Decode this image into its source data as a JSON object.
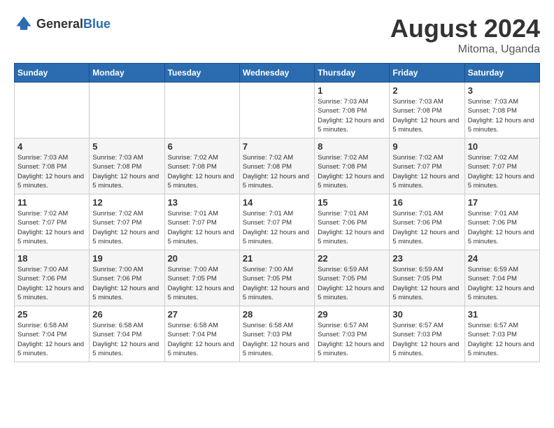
{
  "header": {
    "logo_general": "General",
    "logo_blue": "Blue",
    "month_title": "August 2024",
    "location": "Mitoma, Uganda"
  },
  "weekdays": [
    "Sunday",
    "Monday",
    "Tuesday",
    "Wednesday",
    "Thursday",
    "Friday",
    "Saturday"
  ],
  "weeks": [
    [
      {
        "day": "",
        "sunrise": "",
        "sunset": "",
        "daylight": ""
      },
      {
        "day": "",
        "sunrise": "",
        "sunset": "",
        "daylight": ""
      },
      {
        "day": "",
        "sunrise": "",
        "sunset": "",
        "daylight": ""
      },
      {
        "day": "",
        "sunrise": "",
        "sunset": "",
        "daylight": ""
      },
      {
        "day": "1",
        "sunrise": "Sunrise: 7:03 AM",
        "sunset": "Sunset: 7:08 PM",
        "daylight": "Daylight: 12 hours and 5 minutes."
      },
      {
        "day": "2",
        "sunrise": "Sunrise: 7:03 AM",
        "sunset": "Sunset: 7:08 PM",
        "daylight": "Daylight: 12 hours and 5 minutes."
      },
      {
        "day": "3",
        "sunrise": "Sunrise: 7:03 AM",
        "sunset": "Sunset: 7:08 PM",
        "daylight": "Daylight: 12 hours and 5 minutes."
      }
    ],
    [
      {
        "day": "4",
        "sunrise": "Sunrise: 7:03 AM",
        "sunset": "Sunset: 7:08 PM",
        "daylight": "Daylight: 12 hours and 5 minutes."
      },
      {
        "day": "5",
        "sunrise": "Sunrise: 7:03 AM",
        "sunset": "Sunset: 7:08 PM",
        "daylight": "Daylight: 12 hours and 5 minutes."
      },
      {
        "day": "6",
        "sunrise": "Sunrise: 7:02 AM",
        "sunset": "Sunset: 7:08 PM",
        "daylight": "Daylight: 12 hours and 5 minutes."
      },
      {
        "day": "7",
        "sunrise": "Sunrise: 7:02 AM",
        "sunset": "Sunset: 7:08 PM",
        "daylight": "Daylight: 12 hours and 5 minutes."
      },
      {
        "day": "8",
        "sunrise": "Sunrise: 7:02 AM",
        "sunset": "Sunset: 7:08 PM",
        "daylight": "Daylight: 12 hours and 5 minutes."
      },
      {
        "day": "9",
        "sunrise": "Sunrise: 7:02 AM",
        "sunset": "Sunset: 7:07 PM",
        "daylight": "Daylight: 12 hours and 5 minutes."
      },
      {
        "day": "10",
        "sunrise": "Sunrise: 7:02 AM",
        "sunset": "Sunset: 7:07 PM",
        "daylight": "Daylight: 12 hours and 5 minutes."
      }
    ],
    [
      {
        "day": "11",
        "sunrise": "Sunrise: 7:02 AM",
        "sunset": "Sunset: 7:07 PM",
        "daylight": "Daylight: 12 hours and 5 minutes."
      },
      {
        "day": "12",
        "sunrise": "Sunrise: 7:02 AM",
        "sunset": "Sunset: 7:07 PM",
        "daylight": "Daylight: 12 hours and 5 minutes."
      },
      {
        "day": "13",
        "sunrise": "Sunrise: 7:01 AM",
        "sunset": "Sunset: 7:07 PM",
        "daylight": "Daylight: 12 hours and 5 minutes."
      },
      {
        "day": "14",
        "sunrise": "Sunrise: 7:01 AM",
        "sunset": "Sunset: 7:07 PM",
        "daylight": "Daylight: 12 hours and 5 minutes."
      },
      {
        "day": "15",
        "sunrise": "Sunrise: 7:01 AM",
        "sunset": "Sunset: 7:06 PM",
        "daylight": "Daylight: 12 hours and 5 minutes."
      },
      {
        "day": "16",
        "sunrise": "Sunrise: 7:01 AM",
        "sunset": "Sunset: 7:06 PM",
        "daylight": "Daylight: 12 hours and 5 minutes."
      },
      {
        "day": "17",
        "sunrise": "Sunrise: 7:01 AM",
        "sunset": "Sunset: 7:06 PM",
        "daylight": "Daylight: 12 hours and 5 minutes."
      }
    ],
    [
      {
        "day": "18",
        "sunrise": "Sunrise: 7:00 AM",
        "sunset": "Sunset: 7:06 PM",
        "daylight": "Daylight: 12 hours and 5 minutes."
      },
      {
        "day": "19",
        "sunrise": "Sunrise: 7:00 AM",
        "sunset": "Sunset: 7:06 PM",
        "daylight": "Daylight: 12 hours and 5 minutes."
      },
      {
        "day": "20",
        "sunrise": "Sunrise: 7:00 AM",
        "sunset": "Sunset: 7:05 PM",
        "daylight": "Daylight: 12 hours and 5 minutes."
      },
      {
        "day": "21",
        "sunrise": "Sunrise: 7:00 AM",
        "sunset": "Sunset: 7:05 PM",
        "daylight": "Daylight: 12 hours and 5 minutes."
      },
      {
        "day": "22",
        "sunrise": "Sunrise: 6:59 AM",
        "sunset": "Sunset: 7:05 PM",
        "daylight": "Daylight: 12 hours and 5 minutes."
      },
      {
        "day": "23",
        "sunrise": "Sunrise: 6:59 AM",
        "sunset": "Sunset: 7:05 PM",
        "daylight": "Daylight: 12 hours and 5 minutes."
      },
      {
        "day": "24",
        "sunrise": "Sunrise: 6:59 AM",
        "sunset": "Sunset: 7:04 PM",
        "daylight": "Daylight: 12 hours and 5 minutes."
      }
    ],
    [
      {
        "day": "25",
        "sunrise": "Sunrise: 6:58 AM",
        "sunset": "Sunset: 7:04 PM",
        "daylight": "Daylight: 12 hours and 5 minutes."
      },
      {
        "day": "26",
        "sunrise": "Sunrise: 6:58 AM",
        "sunset": "Sunset: 7:04 PM",
        "daylight": "Daylight: 12 hours and 5 minutes."
      },
      {
        "day": "27",
        "sunrise": "Sunrise: 6:58 AM",
        "sunset": "Sunset: 7:04 PM",
        "daylight": "Daylight: 12 hours and 5 minutes."
      },
      {
        "day": "28",
        "sunrise": "Sunrise: 6:58 AM",
        "sunset": "Sunset: 7:03 PM",
        "daylight": "Daylight: 12 hours and 5 minutes."
      },
      {
        "day": "29",
        "sunrise": "Sunrise: 6:57 AM",
        "sunset": "Sunset: 7:03 PM",
        "daylight": "Daylight: 12 hours and 5 minutes."
      },
      {
        "day": "30",
        "sunrise": "Sunrise: 6:57 AM",
        "sunset": "Sunset: 7:03 PM",
        "daylight": "Daylight: 12 hours and 5 minutes."
      },
      {
        "day": "31",
        "sunrise": "Sunrise: 6:57 AM",
        "sunset": "Sunset: 7:03 PM",
        "daylight": "Daylight: 12 hours and 5 minutes."
      }
    ]
  ]
}
